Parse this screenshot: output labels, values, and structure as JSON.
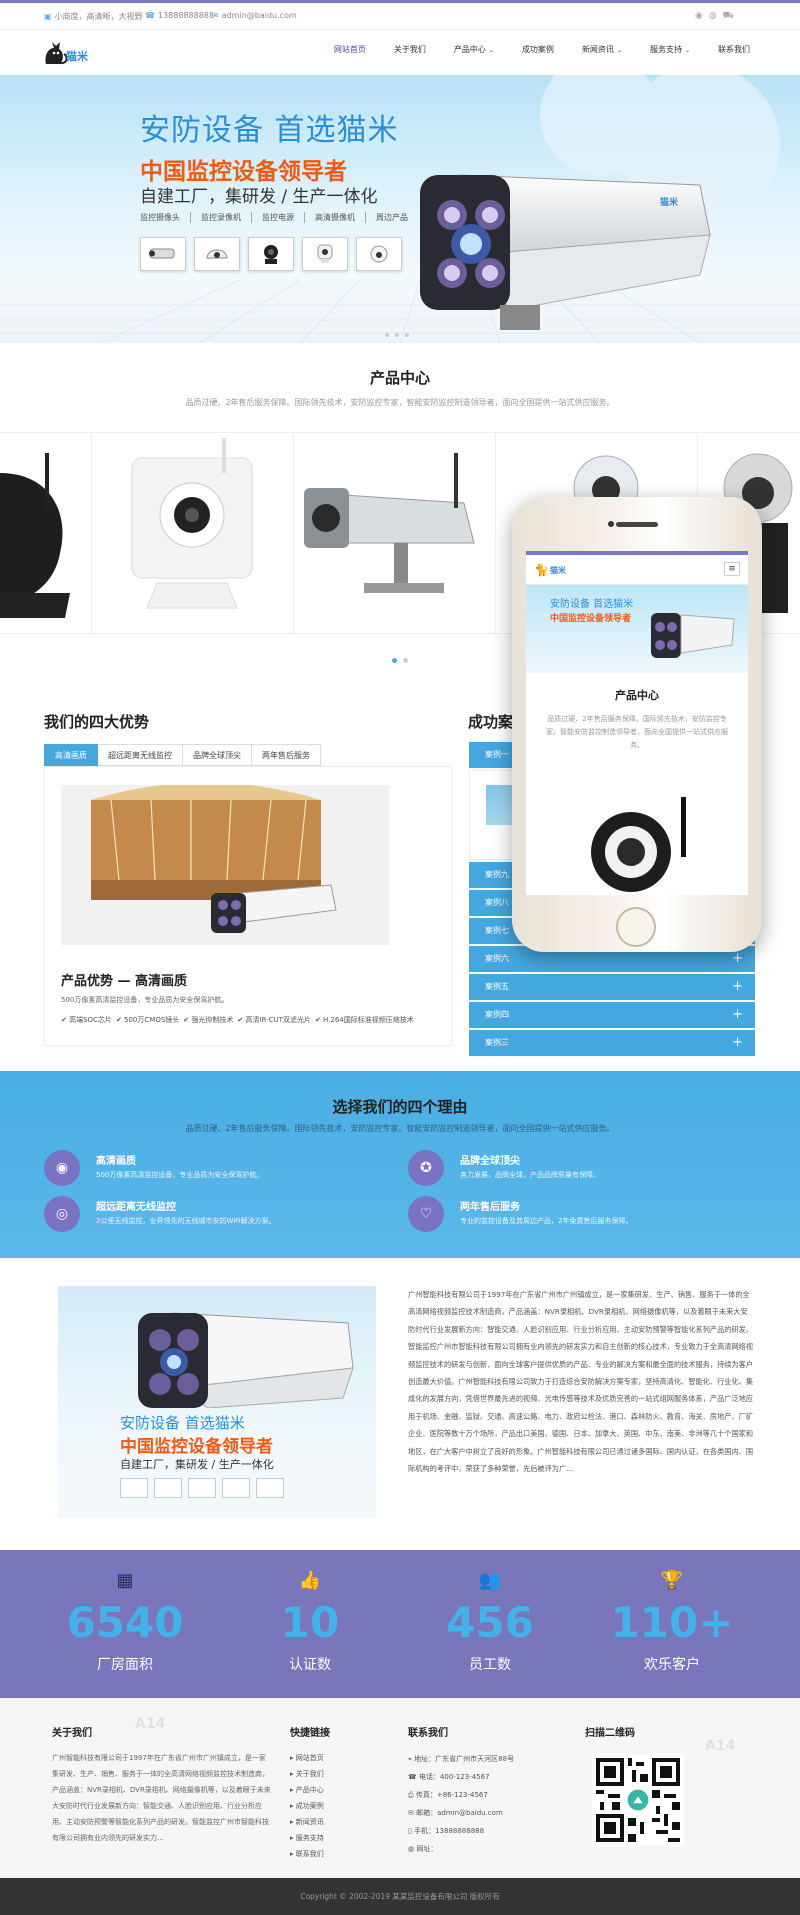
{
  "topbar": {
    "slogan": "小商度，高清晰，大视野",
    "phone": "13888888888",
    "email": "admin@baidu.com"
  },
  "nav": {
    "items": [
      "网站首页",
      "关于我们",
      "产品中心",
      "成功案例",
      "新闻资讯",
      "服务支持",
      "联系我们"
    ],
    "logo_text": "猫米"
  },
  "banner": {
    "line1": "安防设备 首选猫米",
    "line2": "中国监控设备领导者",
    "line3": "自建工厂，集研发 / 生产一体化",
    "categories": [
      "监控摄像头",
      "监控录像机",
      "监控电源",
      "高清摄像机",
      "周边产品"
    ],
    "camera_brand": "猫米"
  },
  "products": {
    "title": "产品中心",
    "subtitle": "品质过硬、2年售后服务保障。国际领先技术，安防监控专家，智能安防监控制造领导者，面向全国提供一站式供应服务。"
  },
  "advantages": {
    "title": "我们的四大优势",
    "tabs": [
      "高清画质",
      "超远距离无线监控",
      "品牌全球顶尖",
      "两年售后服务"
    ],
    "heading": "产品优势 — 高清画质",
    "desc": "500万像素高清监控设备，专业品质为安全保驾护航。",
    "features": [
      "✔ 高端SOC芯片",
      "✔ 500万CMOS镜头",
      "✔ 强光抑制技术",
      "✔ 高清IR-CUT双滤光片",
      "✔ H.264国际标准视频压缩技术"
    ]
  },
  "cases": {
    "title": "成功案",
    "items": [
      "案例一",
      "案例九",
      "案例八",
      "案例七",
      "案例六",
      "案例五",
      "案例四",
      "案例三"
    ]
  },
  "reasons": {
    "title": "选择我们的四个理由",
    "subtitle": "品质过硬、2年售后服务保障。国际领先技术，安防监控专家。智能安防监控制造领导者，面向全国提供一站式供应服务。",
    "items": [
      {
        "title": "高清画质",
        "desc": "500万像素高清监控设备，专业品质为安全保驾护航。",
        "icon": "eye-icon"
      },
      {
        "title": "品牌全球顶尖",
        "desc": "务力发展，品牌全球，产品品牌质量有保障。",
        "icon": "star-badge-icon"
      },
      {
        "title": "超远距离无线监控",
        "desc": "2公里无线监控，业界领先的无线城市安防WiFi解决方案。",
        "icon": "wifi-icon"
      },
      {
        "title": "两年售后服务",
        "desc": "专业的监控设备及其周边产品，2年免费售后服务保障。",
        "icon": "heart-icon"
      }
    ]
  },
  "about": {
    "text": "广州智能科技有限公司于1997年在广东省广州市广州镇成立，是一家集研发、生产、销售、服务于一体的全高清网络视频监控技术制造商，产品涵盖：NVR录相机、DVR录相机、网络摄像机等，以及着眼于未来大安防时代行业发展新方向：智能交通、人脸识别应用、行业分析应用、主动安防预警等智能化系列产品的研发。智能监控广州市智能科技有限公司拥有业内领先的研发实力和自主创新的核心技术，专业致力于全高清网络视频监控技术的研发与创新，面向全球客户提供优质的产品、专业的解决方案和最全面的技术服务，持续为客户创造最大价值。广州智能科技有限公司致力于打造综合安防解决方案专家，坚持高清化、智能化、行业化、集成化的发展方向，凭借世界最先进的视频、光电传感等技术及优质完善的一站式组网服务体系，产品广泛地应用于机场、金融、监狱、交通、高速公路、电力、政府公检法、港口、森林防火、教育、海关、房地产、厂矿企业、医院等数十万个场所，产品出口美国、德国、日本、加拿大、英国、中东、南美、非洲等几十个国家和地区，在广大客户中树立了良好的形象。广州智能科技有限公司已通过诸多国际、国内认证，在各类国内、国际机构的考评中，荣获了多种荣誉，先后被评为广..."
  },
  "stats": [
    {
      "value": "6540",
      "label": "厂房面积",
      "icon": "building-icon"
    },
    {
      "value": "10",
      "label": "认证数",
      "icon": "thumbs-up-icon"
    },
    {
      "value": "456",
      "label": "员工数",
      "icon": "group-icon"
    },
    {
      "value": "110+",
      "label": "欢乐客户",
      "icon": "trophy-icon"
    }
  ],
  "footer": {
    "about_title": "关于我们",
    "about_text": "广州智能科技有限公司于1997年在广东省广州市广州镇成立，是一家集研发、生产、销售、服务于一体的全高清网络视频监控技术制造商，产品涵盖：NVR录相机、DVR录相机、网络摄像机等，以及着眼于未来大安防时代行业发展新方向：智能交通、人脸识别应用、行业分析应用、主动安防预警等智能化系列产品的研发。智能监控广州市智能科技有限公司拥有业内领先的研发实力...",
    "links_title": "快捷链接",
    "links": [
      "网站首页",
      "关于我们",
      "产品中心",
      "成功案例",
      "新闻资讯",
      "服务支持",
      "联系我们"
    ],
    "contact_title": "联系我们",
    "contact": [
      {
        "icon": "location-icon",
        "text": "地址：广东省广州市天河区88号"
      },
      {
        "icon": "phone-icon",
        "text": "电话：400-123-4567"
      },
      {
        "icon": "fax-icon",
        "text": "传真：+86-123-4567"
      },
      {
        "icon": "mail-icon",
        "text": "邮箱：admin@baidu.com"
      },
      {
        "icon": "mobile-icon",
        "text": "手机：13888888888"
      },
      {
        "icon": "globe-icon",
        "text": "网址："
      }
    ],
    "qr_title": "扫描二维码",
    "watermark": "A14"
  },
  "copyright": "Copyright © 2002-2019 某某监控设备有限公司 版权所有",
  "phone_mock": {
    "slogan1": "安防设备 首选猫米",
    "slogan2": "中国监控设备领导者",
    "title": "产品中心",
    "subtitle": "品质过硬、2年售后服务保障。国际领先技术，安防监控专家。智能安防监控制造领导者，面向全国提供一站式供应服务。",
    "logo_text": "猫米"
  },
  "colors": {
    "accent": "#44a7e0",
    "purple": "#7976bc",
    "orange": "#ee5b14"
  }
}
